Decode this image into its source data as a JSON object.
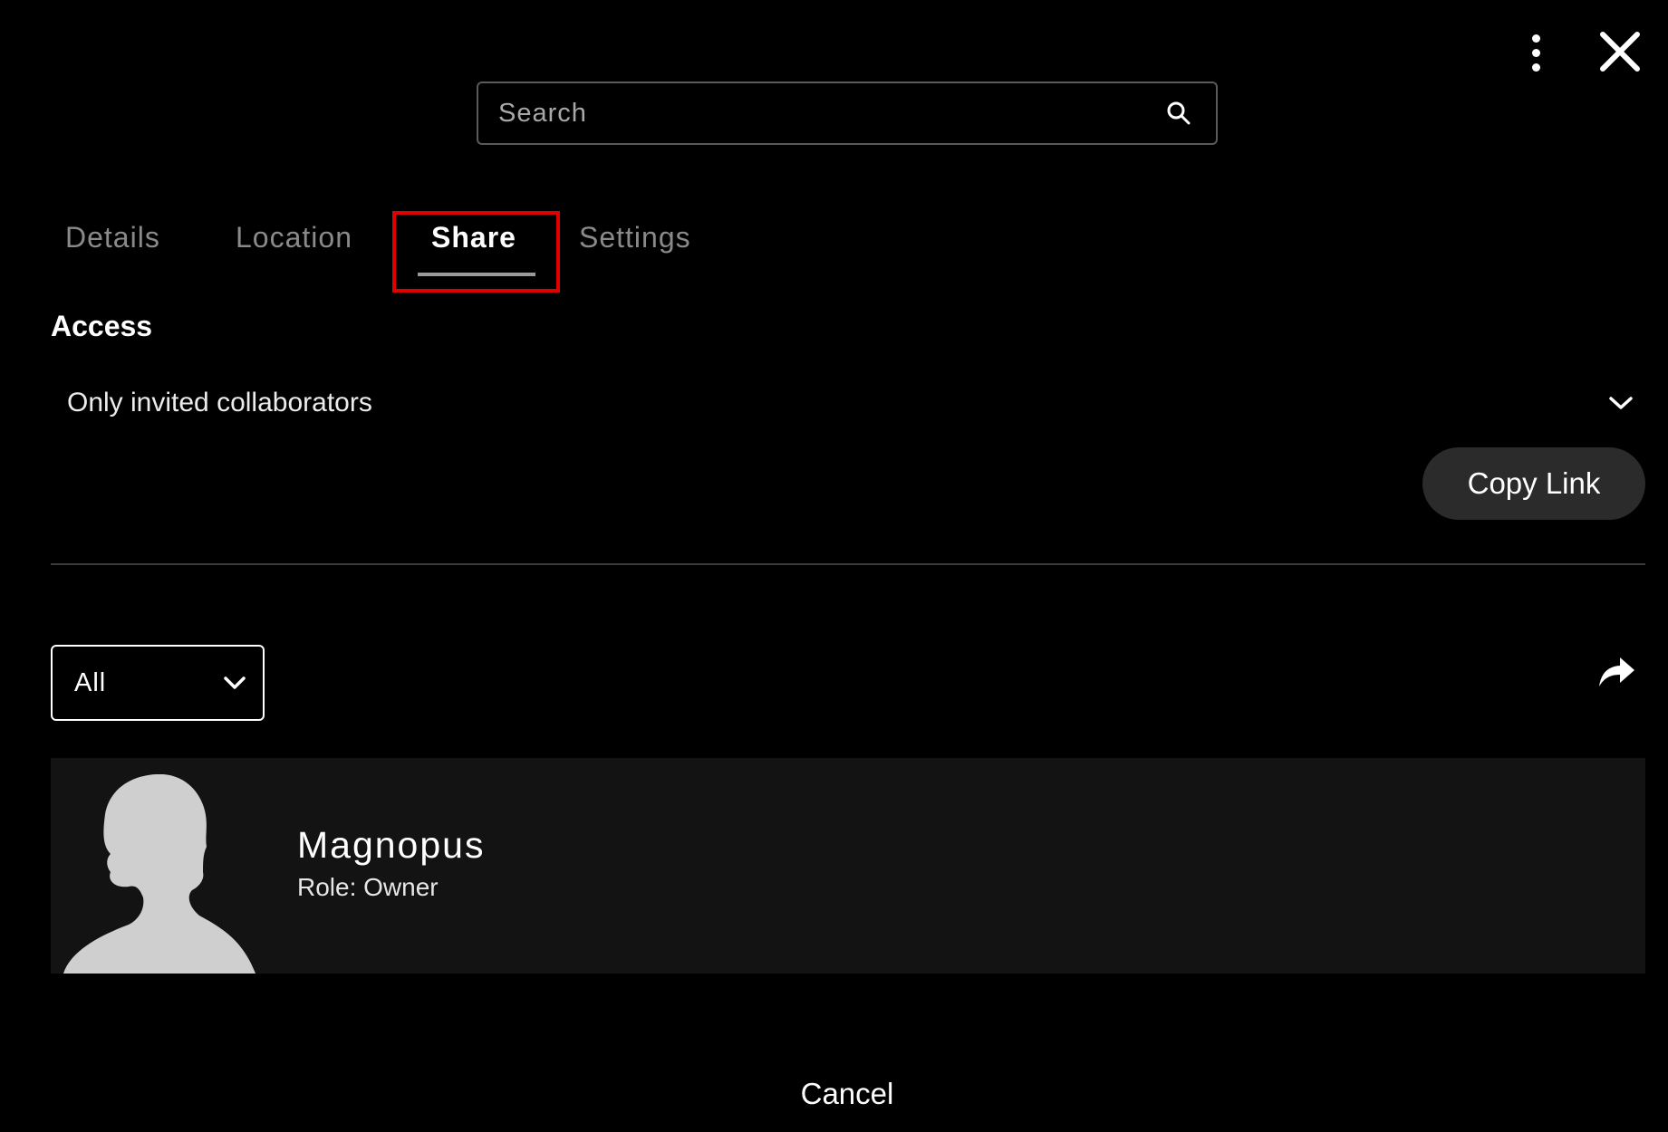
{
  "header": {
    "more_icon": "kebab-vertical-icon",
    "close_icon": "close-x-icon"
  },
  "search": {
    "placeholder": "Search",
    "icon": "magnifier-icon"
  },
  "tabs": [
    {
      "label": "Details",
      "active": false
    },
    {
      "label": "Location",
      "active": false
    },
    {
      "label": "Share",
      "active": true
    },
    {
      "label": "Settings",
      "active": false
    }
  ],
  "access": {
    "title": "Access",
    "selected": "Only invited collaborators",
    "copy_link_label": "Copy Link"
  },
  "members": {
    "filter_selected": "All",
    "share_icon": "share-arrow-icon",
    "list": [
      {
        "name": "Magnopus",
        "role": "Role: Owner"
      }
    ]
  },
  "footer": {
    "cancel_label": "Cancel"
  },
  "colors": {
    "background": "#000000",
    "highlight": "#e00000",
    "row_background": "#131313",
    "button_background": "#2b2b2b",
    "avatar": "#cfcfcf"
  }
}
